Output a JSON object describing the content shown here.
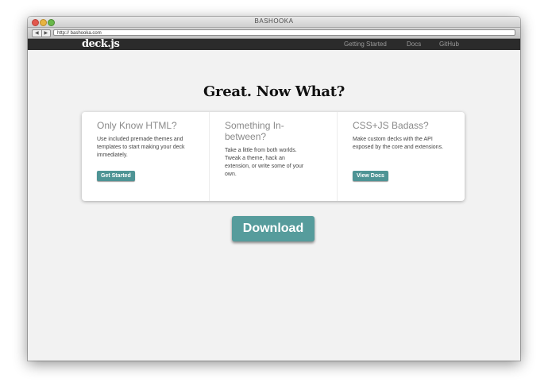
{
  "window": {
    "title": "BASHOOKA",
    "url": "http:// bashooka.com",
    "back_glyph": "◀",
    "forward_glyph": "▶"
  },
  "site": {
    "logo": "deck.js",
    "nav": [
      "Getting Started",
      "Docs",
      "GitHub"
    ]
  },
  "main": {
    "headline": "Great. Now What?",
    "cards": [
      {
        "title": "Only Know HTML?",
        "text": "Use included premade themes and templates to start making your deck immediately.",
        "button": "Get Started"
      },
      {
        "title": "Something In-between?",
        "text": "Take a little from both worlds. Tweak a theme, hack an extension, or write some of your own.",
        "button": ""
      },
      {
        "title": "CSS+JS Badass?",
        "text": "Make custom decks with the API exposed by the core and extensions.",
        "button": "View Docs"
      }
    ],
    "download": "Download"
  },
  "colors": {
    "accent": "#569c9c",
    "navbar": "#2b2b2b",
    "page": "#f2f2f2"
  }
}
